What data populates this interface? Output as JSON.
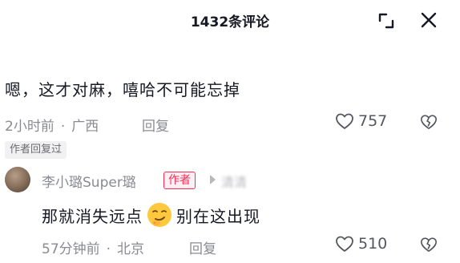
{
  "header": {
    "title": "1432条评论"
  },
  "comment": {
    "text": "嗯，这才对麻，嘻哈不可能忘掉",
    "time": "2小时前",
    "location": "广西",
    "reply_label": "回复",
    "likes": "757",
    "author_replied_tag": "作者回复过"
  },
  "reply": {
    "username": "李小璐Super璐",
    "author_badge": "作者",
    "reply_to": "▸",
    "reply_to_name": "清清",
    "text_before": "那就消失远点",
    "text_after": "别在这出现",
    "time": "57分钟前",
    "location": "北京",
    "reply_label": "回复",
    "likes": "510"
  },
  "icons": {
    "expand": "expand-icon",
    "close": "close-icon",
    "like": "heart-outline-icon",
    "dislike": "broken-heart-icon",
    "emoji": "smirk-emoji"
  }
}
